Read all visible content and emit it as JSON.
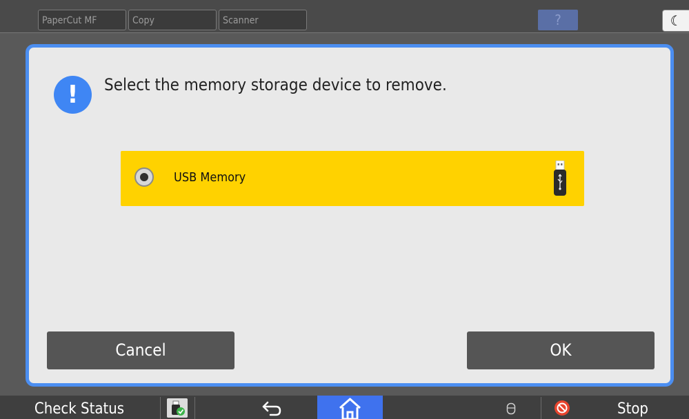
{
  "topbar": {
    "tabs": [
      {
        "label": "PaperCut MF"
      },
      {
        "label": "Copy"
      },
      {
        "label": "Scanner"
      }
    ],
    "help_label": "?",
    "night_label": "☾"
  },
  "dialog": {
    "message": "Select the memory storage device to remove.",
    "device": {
      "label": "USB Memory",
      "selected": true
    },
    "cancel_label": "Cancel",
    "ok_label": "OK"
  },
  "bottombar": {
    "check_status_label": "Check Status",
    "stop_label": "Stop"
  },
  "colors": {
    "accent": "#4b8ef1",
    "selection": "#ffd200",
    "home": "#3f72ee",
    "stop": "#e8452e"
  },
  "icons": [
    "alert-icon",
    "radio-selected-icon",
    "usb-drive-icon",
    "device-status-icon",
    "back-arrow-icon",
    "home-icon",
    "data-icon",
    "stop-icon",
    "help-icon",
    "night-mode-icon"
  ]
}
